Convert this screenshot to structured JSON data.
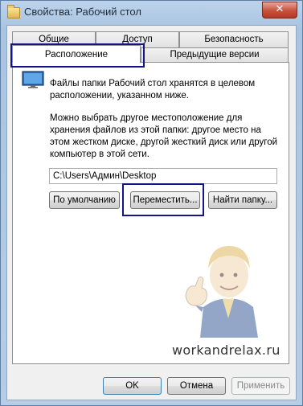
{
  "window": {
    "title": "Свойства: Рабочий стол",
    "close_glyph": "✕"
  },
  "tabs": [
    {
      "label": "Общие"
    },
    {
      "label": "Доступ"
    },
    {
      "label": "Безопасность"
    },
    {
      "label": "Расположение",
      "active": true
    },
    {
      "label": "Предыдущие версии"
    }
  ],
  "panel": {
    "info_text": "Файлы папки Рабочий стол хранятся в целевом расположении, указанном ниже.",
    "description": "Можно выбрать другое местоположение для хранения файлов из этой папки: другое место на этом жестком диске, другой жесткий диск или другой компьютер в этой сети.",
    "path_value": "C:\\Users\\Админ\\Desktop",
    "buttons": {
      "default": "По умолчанию",
      "move": "Переместить...",
      "find": "Найти папку..."
    }
  },
  "footer": {
    "ok": "OK",
    "cancel": "Отмена",
    "apply": "Применить"
  },
  "watermark": "workandrelax.ru",
  "colors": {
    "highlight": "#14148a",
    "window_frame": "#a9c4e1",
    "close_button": "#c8503a"
  },
  "icons": {
    "title": "folder-icon",
    "info": "monitor-icon",
    "close": "close-icon"
  }
}
